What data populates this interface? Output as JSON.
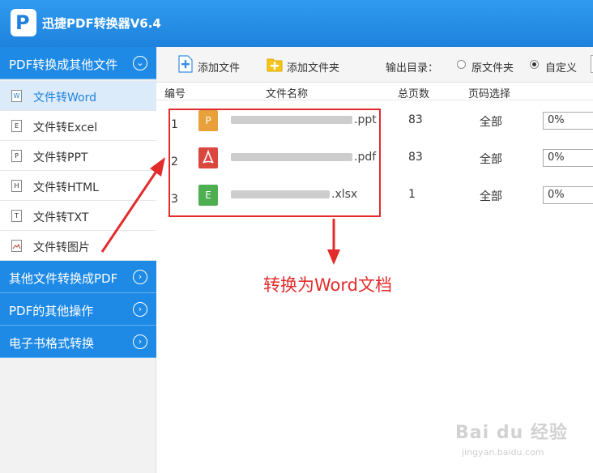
{
  "app": {
    "title": "迅捷PDF转换器V6.4"
  },
  "sidebar": {
    "category_1": "PDF转换成其他文件",
    "items": [
      {
        "label": "文件转Word",
        "icon": "W"
      },
      {
        "label": "文件转Excel",
        "icon": "E"
      },
      {
        "label": "文件转PPT",
        "icon": "P"
      },
      {
        "label": "文件转HTML",
        "icon": "H"
      },
      {
        "label": "文件转TXT",
        "icon": "T"
      },
      {
        "label": "文件转图片",
        "icon": "img"
      }
    ],
    "category_2": "其他文件转换成PDF",
    "category_3": "PDF的其他操作",
    "category_4": "电子书格式转换"
  },
  "toolbar": {
    "add_file": "添加文件",
    "add_folder": "添加文件夹",
    "output_label": "输出目录：",
    "option_original": "原文件夹",
    "option_custom": "自定义",
    "selected_option": "自定义"
  },
  "table": {
    "headers": {
      "index": "编号",
      "name": "文件名称",
      "pages": "总页数",
      "range": "页码选择"
    },
    "rows": [
      {
        "index": "1",
        "icon": "P",
        "name_suffix": ".ppt",
        "pages": "83",
        "range": "全部",
        "progress": "0%",
        "color": "#e8a03a"
      },
      {
        "index": "2",
        "icon": "pdf",
        "name_suffix": ".pdf",
        "pages": "83",
        "range": "全部",
        "progress": "0%",
        "color": "#d9473f"
      },
      {
        "index": "3",
        "icon": "E",
        "name_suffix": ".xlsx",
        "pages": "1",
        "range": "全部",
        "progress": "0%",
        "color": "#4caf50"
      }
    ]
  },
  "annotation": {
    "text": "转换为Word文档",
    "color": "#e32b2b"
  },
  "watermark": {
    "brand": "Bai du 经验",
    "url": "jingyan.baidu.com"
  }
}
